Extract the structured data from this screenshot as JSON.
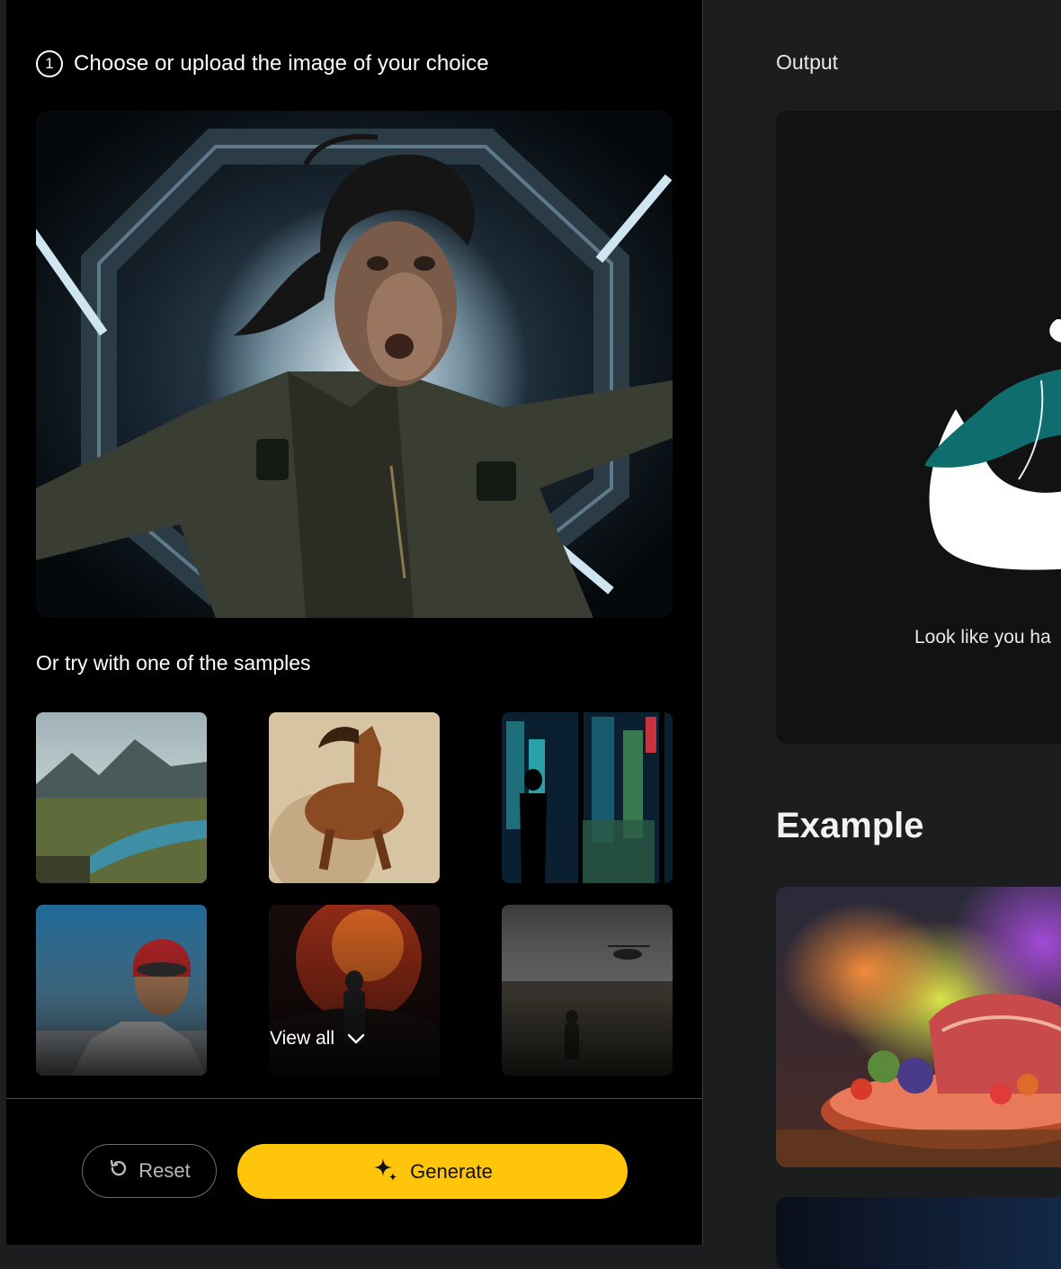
{
  "left": {
    "step_number": "1",
    "step_title": "Choose or upload the image of your choice",
    "samples_label": "Or try with one of the samples",
    "samples": [
      {
        "name": "sample-mountain-river"
      },
      {
        "name": "sample-running-horse"
      },
      {
        "name": "sample-neon-city"
      },
      {
        "name": "sample-astronaut-portrait"
      },
      {
        "name": "sample-fire-explorer"
      },
      {
        "name": "sample-helicopter-wasteland"
      }
    ],
    "view_all_label": "View all",
    "reset_label": "Reset",
    "generate_label": "Generate"
  },
  "right": {
    "output_title": "Output",
    "empty_message": "Look like you ha",
    "example_title": "Example"
  },
  "colors": {
    "accent": "#fec50a",
    "left_bg": "#000000",
    "right_bg": "#1b1d1e",
    "card_bg": "#121212",
    "illustration_teal": "#0f6d6d"
  },
  "icons": {
    "view_all": "chevron-down-icon",
    "reset": "reset-icon",
    "generate": "sparkle-icon"
  }
}
